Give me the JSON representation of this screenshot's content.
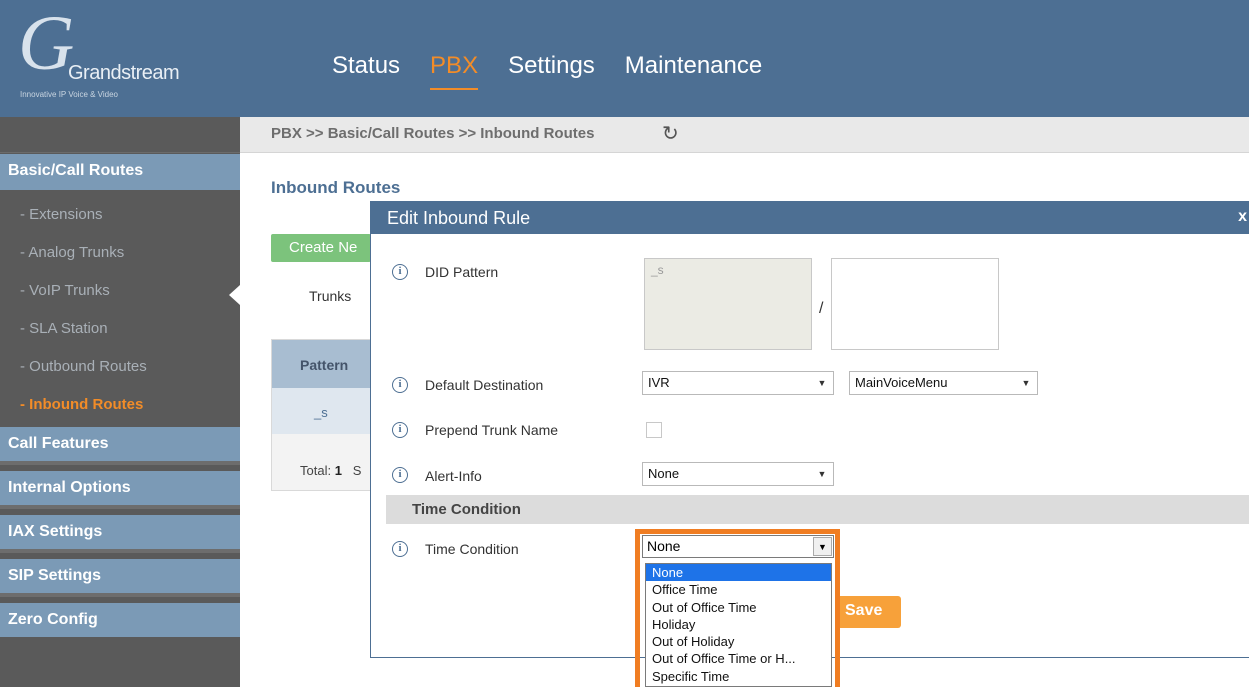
{
  "brand": {
    "logo_text": "Grandstream",
    "tagline": "Innovative IP Voice & Video"
  },
  "nav": {
    "items": [
      "Status",
      "PBX",
      "Settings",
      "Maintenance"
    ],
    "active": "PBX"
  },
  "breadcrumb": "PBX >> Basic/Call Routes >> Inbound Routes",
  "sidebar": {
    "section_basic": "Basic/Call Routes",
    "sub_items": [
      "Extensions",
      "Analog Trunks",
      "VoIP Trunks",
      "SLA Station",
      "Outbound Routes",
      "Inbound Routes"
    ],
    "active_sub": "Inbound Routes",
    "sections": [
      "Call Features",
      "Internal Options",
      "IAX Settings",
      "SIP Settings",
      "Zero Config"
    ]
  },
  "page": {
    "title": "Inbound Routes",
    "create_button": "Create Ne",
    "trunks_label": "Trunks",
    "table": {
      "header": "Pattern",
      "row_value": "_s",
      "total_label": "Total:",
      "total_value": "1",
      "extra": "S"
    }
  },
  "modal": {
    "title": "Edit Inbound Rule",
    "close": "x",
    "did_pattern_label": "DID Pattern",
    "did_pattern_value": "_s",
    "did_slash": "/",
    "default_destination_label": "Default Destination",
    "default_destination_value": "IVR",
    "ivr_value": "MainVoiceMenu",
    "prepend_trunk_label": "Prepend Trunk Name",
    "alert_info_label": "Alert-Info",
    "alert_info_value": "None",
    "section_title": "Time Condition",
    "time_condition_label": "Time Condition",
    "time_condition_value": "None",
    "time_condition_options": [
      "None",
      "Office Time",
      "Out of Office Time",
      "Holiday",
      "Out of Holiday",
      "Out of Office Time or H...",
      "Specific Time"
    ],
    "save_label": "Save"
  },
  "colors": {
    "header": "#4d6f93",
    "accent": "#f28c28",
    "highlight": "#f07d22"
  }
}
